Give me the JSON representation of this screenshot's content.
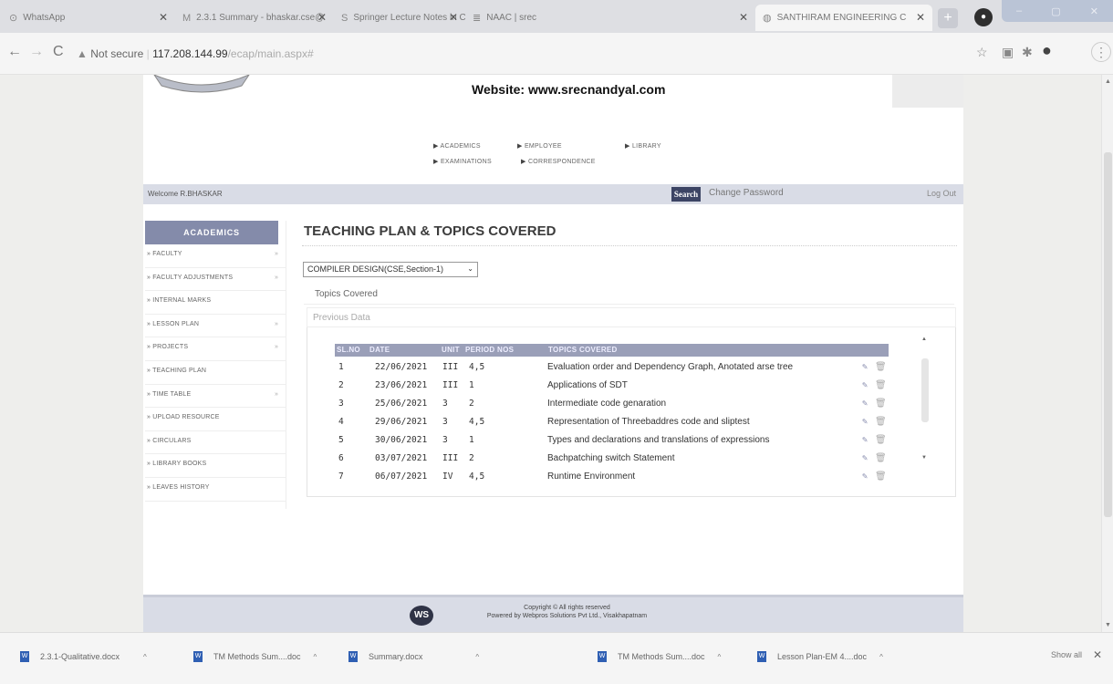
{
  "browser": {
    "tabs": [
      {
        "title": "WhatsApp",
        "icon": "whatsapp-icon",
        "glyph": "⊙"
      },
      {
        "title": "2.3.1 Summary - bhaskar.cse@",
        "icon": "gmail-icon",
        "glyph": "M"
      },
      {
        "title": "Springer Lecture Notes in Co",
        "icon": "springer-icon",
        "glyph": "S"
      },
      {
        "title": "NAAC | srec",
        "icon": "naac-icon",
        "glyph": "≣"
      },
      {
        "title": "SANTHIRAM ENGINEERING C",
        "icon": "globe-icon",
        "glyph": "◍"
      }
    ],
    "new_tab": "+",
    "window_controls": [
      "–",
      "▢",
      "✕"
    ],
    "nav": {
      "back": "←",
      "forward": "→",
      "reload": "C"
    },
    "address": {
      "not_secure": "Not secure",
      "host": "117.208.144.99",
      "path": "/ecap/main.aspx#"
    }
  },
  "header": {
    "website": "Website: www.srecnandyal.com"
  },
  "top_nav": {
    "academics": "ACADEMICS",
    "employee": "EMPLOYEE",
    "library": "LIBRARY",
    "examinations": "EXAMINATIONS",
    "correspondence": "CORRESPONDENCE"
  },
  "welcome_bar": {
    "welcome": "Welcome R.BHASKAR",
    "search": "Search",
    "change_password": "Change Password",
    "logout": "Log Out"
  },
  "sidebar": {
    "heading": "ACADEMICS",
    "items": [
      {
        "label": "FACULTY",
        "chevron": true
      },
      {
        "label": "FACULTY ADJUSTMENTS",
        "chevron": true
      },
      {
        "label": "INTERNAL MARKS",
        "chevron": false
      },
      {
        "label": "LESSON PLAN",
        "chevron": true
      },
      {
        "label": "PROJECTS",
        "chevron": true
      },
      {
        "label": "TEACHING PLAN",
        "chevron": false
      },
      {
        "label": "TIME TABLE",
        "chevron": true
      },
      {
        "label": "UPLOAD RESOURCE",
        "chevron": false
      },
      {
        "label": "CIRCULARS",
        "chevron": false
      },
      {
        "label": "LIBRARY BOOKS",
        "chevron": false
      },
      {
        "label": "LEAVES HISTORY",
        "chevron": false
      }
    ]
  },
  "main": {
    "title": "TEACHING PLAN & TOPICS COVERED",
    "course_select": "COMPILER DESIGN(CSE,Section-1)",
    "topics_covered": "Topics Covered",
    "previous_data": "Previous Data",
    "table": {
      "headers": {
        "slno": "SL.NO",
        "date": "DATE",
        "unit": "UNIT",
        "period": "PERIOD NOS",
        "topics": "TOPICS COVERED"
      },
      "rows": [
        {
          "slno": "1",
          "date": "22/06/2021",
          "unit": "III",
          "period": "4,5",
          "topic": "Evaluation order and Dependency Graph, Anotated arse tree"
        },
        {
          "slno": "2",
          "date": "23/06/2021",
          "unit": "III",
          "period": "1",
          "topic": "Applications of SDT"
        },
        {
          "slno": "3",
          "date": "25/06/2021",
          "unit": "3",
          "period": "2",
          "topic": "Intermediate code genaration"
        },
        {
          "slno": "4",
          "date": "29/06/2021",
          "unit": "3",
          "period": "4,5",
          "topic": "Representation of Threebaddres code and sliptest"
        },
        {
          "slno": "5",
          "date": "30/06/2021",
          "unit": "3",
          "period": "1",
          "topic": "Types and declarations and translations of expressions"
        },
        {
          "slno": "6",
          "date": "03/07/2021",
          "unit": "III",
          "period": "2",
          "topic": "Bachpatching switch Statement"
        },
        {
          "slno": "7",
          "date": "06/07/2021",
          "unit": "IV",
          "period": "4,5",
          "topic": "Runtime Environment"
        }
      ]
    }
  },
  "footer": {
    "logo": "WS",
    "line1": "Copyright © All rights reserved",
    "line2": "Powered by Webpros Solutions Pvt Ltd., Visakhapatnam"
  },
  "downloads": {
    "items": [
      "2.3.1-Qualitative.docx",
      "TM Methods Sum....doc",
      "Summary.docx",
      "TM Methods Sum....doc",
      "Lesson Plan-EM 4....doc"
    ],
    "show_all": "Show all",
    "close": "✕"
  }
}
